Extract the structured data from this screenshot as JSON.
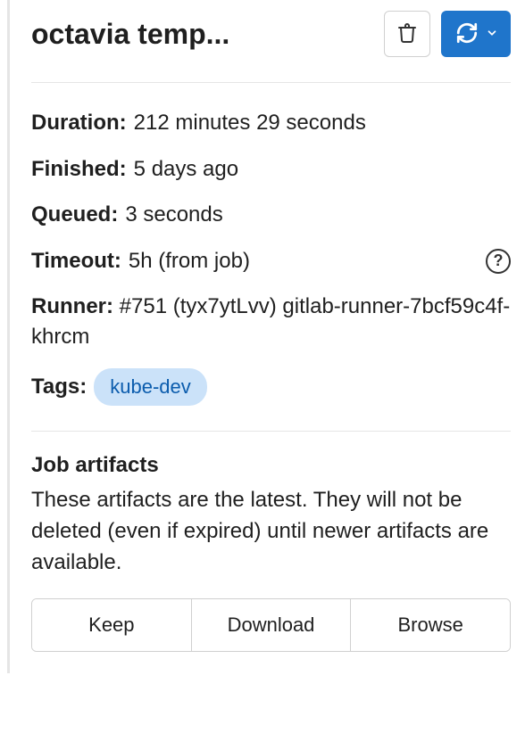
{
  "header": {
    "title": "octavia temp...",
    "delete_label": "Delete",
    "retry_label": "Retry"
  },
  "meta": {
    "duration_label": "Duration:",
    "duration_value": "212 minutes 29 seconds",
    "finished_label": "Finished:",
    "finished_value": "5 days ago",
    "queued_label": "Queued:",
    "queued_value": "3 seconds",
    "timeout_label": "Timeout:",
    "timeout_value": "5h (from job)",
    "runner_label": "Runner:",
    "runner_value": "#751 (tyx7ytLvv) gitlab-runner-7bcf59c4f-khrcm",
    "tags_label": "Tags:",
    "tags": [
      "kube-dev"
    ]
  },
  "artifacts": {
    "title": "Job artifacts",
    "description": "These artifacts are the latest. They will not be deleted (even if expired) until newer artifacts are available.",
    "keep_label": "Keep",
    "download_label": "Download",
    "browse_label": "Browse"
  },
  "colors": {
    "primary": "#1f75cb",
    "tag_bg": "#cbe2f9",
    "tag_fg": "#0b5cad",
    "border": "#d0d0d0"
  }
}
